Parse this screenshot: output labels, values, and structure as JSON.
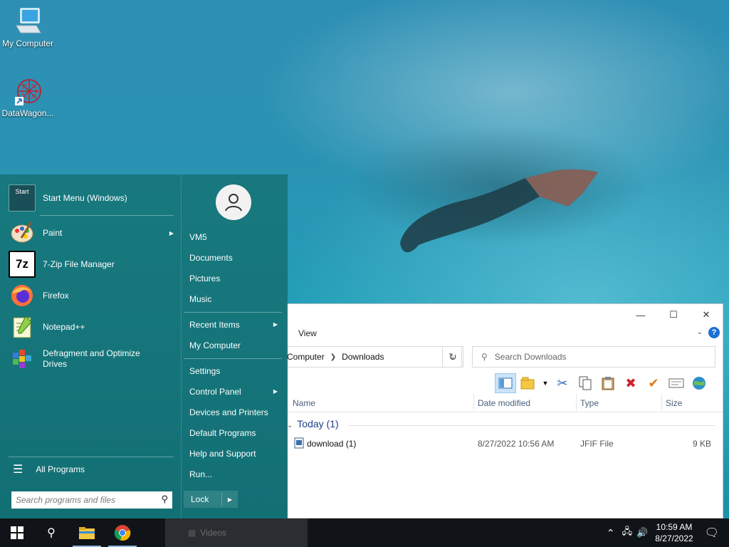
{
  "desktop": {
    "icons": [
      {
        "label": "My Computer",
        "icon": "computer-icon"
      },
      {
        "label": "DataWagon...",
        "icon": "datawagon-shortcut-icon"
      }
    ]
  },
  "explorer": {
    "ribbon_tab": "View",
    "address": {
      "segment1": "Computer",
      "segment2": "Downloads"
    },
    "search_placeholder": "Search Downloads",
    "columns": {
      "name": "Name",
      "date": "Date modified",
      "type": "Type",
      "size": "Size"
    },
    "group": "Today (1)",
    "files": [
      {
        "name": "download (1)",
        "date": "8/27/2022 10:56 AM",
        "type": "JFIF File",
        "size": "9 KB"
      }
    ]
  },
  "start_menu": {
    "pinned": [
      {
        "label": "Start Menu (Windows)",
        "icon": "start-menu-icon"
      },
      {
        "label": "Paint",
        "icon": "paint-icon",
        "submenu": true
      },
      {
        "label": "7-Zip File Manager",
        "icon": "7zip-icon"
      },
      {
        "label": "Firefox",
        "icon": "firefox-icon"
      },
      {
        "label": "Notepad++",
        "icon": "notepadpp-icon"
      },
      {
        "label": "Defragment and Optimize Drives",
        "label_line1": "Defragment and Optimize",
        "label_line2": "Drives",
        "icon": "defrag-icon"
      }
    ],
    "start_icon_text": "Start",
    "all_programs": "All Programs",
    "search_placeholder": "Search programs and files",
    "right_items": {
      "user": "VM5",
      "documents": "Documents",
      "pictures": "Pictures",
      "music": "Music",
      "recent": "Recent Items",
      "computer": "My Computer",
      "settings": "Settings",
      "control_panel": "Control Panel",
      "devices": "Devices and Printers",
      "default_programs": "Default Programs",
      "help": "Help and Support",
      "run": "Run..."
    },
    "lock": "Lock"
  },
  "taskbar": {
    "window_title": "Videos",
    "time": "10:59 AM",
    "date": "8/27/2022"
  },
  "colors": {
    "accent": "#16767a",
    "taskbar": "#101418",
    "link_blue": "#1e3f87"
  }
}
